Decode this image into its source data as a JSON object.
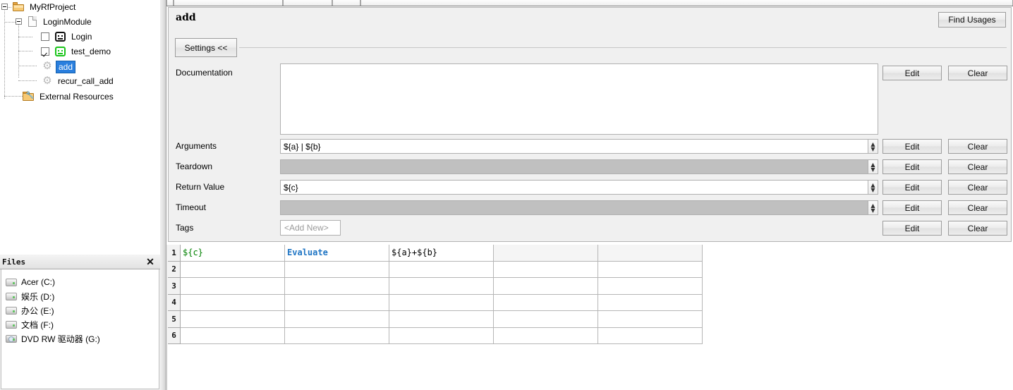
{
  "tree": {
    "nodes": [
      {
        "label": "MyRfProject",
        "icon": "folder-icon",
        "depth": 0,
        "expander": true,
        "checkbox": false,
        "selected": false
      },
      {
        "label": "LoginModule",
        "icon": "file-icon",
        "depth": 1,
        "expander": true,
        "checkbox": false,
        "selected": false
      },
      {
        "label": "Login",
        "icon": "robot-icon",
        "depth": 2,
        "expander": false,
        "checkbox": true,
        "checked": false,
        "selected": false
      },
      {
        "label": "test_demo",
        "icon": "robot-green-icon",
        "depth": 2,
        "expander": false,
        "checkbox": true,
        "checked": true,
        "selected": false
      },
      {
        "label": "add",
        "icon": "gear-icon",
        "depth": 2,
        "expander": false,
        "checkbox": false,
        "selected": true
      },
      {
        "label": "recur_call_add",
        "icon": "gear-icon",
        "depth": 2,
        "expander": false,
        "checkbox": false,
        "selected": false
      },
      {
        "label": "External Resources",
        "icon": "external-resources-icon",
        "depth": 1,
        "expander": false,
        "checkbox": false,
        "selected": false
      }
    ]
  },
  "files_panel": {
    "title": "Files",
    "close_label": "✕",
    "drives": [
      {
        "label": "Acer (C:)",
        "icon": "hard-drive-icon"
      },
      {
        "label": "娱乐 (D:)",
        "icon": "hard-drive-icon"
      },
      {
        "label": "办公 (E:)",
        "icon": "hard-drive-icon"
      },
      {
        "label": "文档 (F:)",
        "icon": "hard-drive-icon"
      },
      {
        "label": "DVD RW 驱动器 (G:)",
        "icon": "dvd-drive-icon"
      }
    ]
  },
  "editor": {
    "title": "add",
    "find_usages_label": "Find Usages",
    "settings_label": "Settings <<",
    "fields": [
      {
        "label": "Documentation",
        "value": "",
        "type": "textarea",
        "disabled": false,
        "spinner": false,
        "edit_label": "Edit",
        "clear_label": "Clear"
      },
      {
        "label": "Arguments",
        "value": "${a} | ${b}",
        "type": "text",
        "disabled": false,
        "spinner": true,
        "edit_label": "Edit",
        "clear_label": "Clear"
      },
      {
        "label": "Teardown",
        "value": "",
        "type": "text",
        "disabled": true,
        "spinner": true,
        "edit_label": "Edit",
        "clear_label": "Clear"
      },
      {
        "label": "Return Value",
        "value": "${c}",
        "type": "text",
        "disabled": false,
        "spinner": true,
        "edit_label": "Edit",
        "clear_label": "Clear"
      },
      {
        "label": "Timeout",
        "value": "",
        "type": "text",
        "disabled": true,
        "spinner": true,
        "edit_label": "Edit",
        "clear_label": "Clear"
      },
      {
        "label": "Tags",
        "value": "<Add New>",
        "type": "tag",
        "disabled": false,
        "spinner": false,
        "edit_label": "Edit",
        "clear_label": "Clear"
      }
    ],
    "spinner_up": "▲",
    "spinner_down": "▼"
  },
  "grid": {
    "row_numbers": [
      "1",
      "2",
      "3",
      "4",
      "5",
      "6"
    ],
    "rows": [
      [
        {
          "text": "${c}",
          "color": "green"
        },
        {
          "text": "Evaluate",
          "color": "blue"
        },
        {
          "text": "${a}+${b}",
          "color": "black"
        },
        {
          "text": "",
          "color": "black",
          "shade": true
        },
        {
          "text": "",
          "color": "black",
          "shade": true
        }
      ],
      [
        {
          "text": ""
        },
        {
          "text": ""
        },
        {
          "text": ""
        },
        {
          "text": ""
        },
        {
          "text": ""
        }
      ],
      [
        {
          "text": ""
        },
        {
          "text": ""
        },
        {
          "text": ""
        },
        {
          "text": ""
        },
        {
          "text": ""
        }
      ],
      [
        {
          "text": ""
        },
        {
          "text": ""
        },
        {
          "text": ""
        },
        {
          "text": ""
        },
        {
          "text": ""
        }
      ],
      [
        {
          "text": ""
        },
        {
          "text": ""
        },
        {
          "text": ""
        },
        {
          "text": ""
        },
        {
          "text": ""
        }
      ],
      [
        {
          "text": ""
        },
        {
          "text": ""
        },
        {
          "text": ""
        },
        {
          "text": ""
        },
        {
          "text": ""
        }
      ]
    ]
  },
  "colors": {
    "selection_blue": "#2a7fde",
    "keyword_blue": "#1f75c4",
    "variable_green": "#008000",
    "panel_gray": "#f0f0f0",
    "disabled_gray": "#c0c0c0"
  }
}
